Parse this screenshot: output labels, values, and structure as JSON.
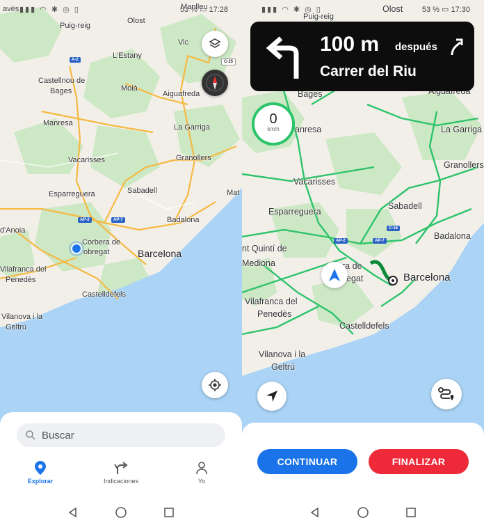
{
  "left_screen": {
    "status": {
      "left_text": "avès",
      "battery": "53 %",
      "time": "17:28"
    },
    "map_labels": {
      "manlleu": "Manlleu",
      "puig_reig": "Puig-reig",
      "olost": "Olost",
      "vic": "Vic",
      "lestany": "L'Estany",
      "castellnou": "Castellnou de",
      "bages": "Bages",
      "moia": "Moià",
      "aiguafreda": "Aiguafreda",
      "manresa": "Manresa",
      "la_garriga": "La Garriga",
      "vacarisses": "Vacarisses",
      "granollers": "Granollers",
      "esparreguera": "Esparreguera",
      "sabadell": "Sabadell",
      "anoia": "d'Anoia",
      "badalona": "Badalona",
      "corbera1": "Corbera de",
      "corbera2": "obregat",
      "barcelona": "Barcelona",
      "vilafranca1": "Vilafranca del",
      "vilafranca2": "Penedès",
      "castelldefels": "Castelldefels",
      "vilanova1": "Vilanova i la",
      "vilanova2": "Geltrú",
      "mat": "Mat",
      "shield_a2": "A-2",
      "shield_ap2": "AP-2",
      "shield_ap7": "AP-7",
      "shield_c25": "C-25"
    },
    "search_placeholder": "Buscar",
    "tabs": [
      "Explorar",
      "Indicaciones",
      "Yo"
    ]
  },
  "right_screen": {
    "status": {
      "left_text": "",
      "battery": "53 %",
      "time": "17:30"
    },
    "instruction": {
      "distance": "100 m",
      "after": "después",
      "street": "Carrer del Riu"
    },
    "speed": {
      "value": "0",
      "unit": "km/h"
    },
    "map_labels": {
      "puig_reig": "Puig-reig",
      "olost": "Olost",
      "bages": "Bages",
      "aiguafreda": "Aiguafreda",
      "manresa": "anresa",
      "la_garriga": "La Garriga",
      "granollers": "Granollers",
      "vacarisses": "Vacarisses",
      "esparreguera": "Esparreguera",
      "sabadell": "Sabadell",
      "badalona": "Badalona",
      "sant_quinti": "nt Quintí de",
      "mediona": "Mediona",
      "corbera1": "ra de",
      "corbera2": "egat",
      "barcelona": "Barcelona",
      "vilafranca1": "Vilafranca del",
      "vilafranca2": "Penedès",
      "castelldefels": "Castelldefels",
      "vilanova1": "Vilanova i la",
      "vilanova2": "Geltrú",
      "shield_ap2": "AP-2",
      "shield_ap7": "AP-7",
      "shield_c16": "C-16"
    },
    "buttons": {
      "continue": "CONTINUAR",
      "finish": "FINALIZAR"
    }
  },
  "colors": {
    "water": "#aad3f5",
    "green": "#cde8c4",
    "land": "#f2efe9",
    "highway": "#f5b942",
    "route_green": "#2ec36b",
    "primary_blue": "#1a73e8",
    "continue_blue": "#1a73e8",
    "finish_red": "#ee2a3a"
  }
}
